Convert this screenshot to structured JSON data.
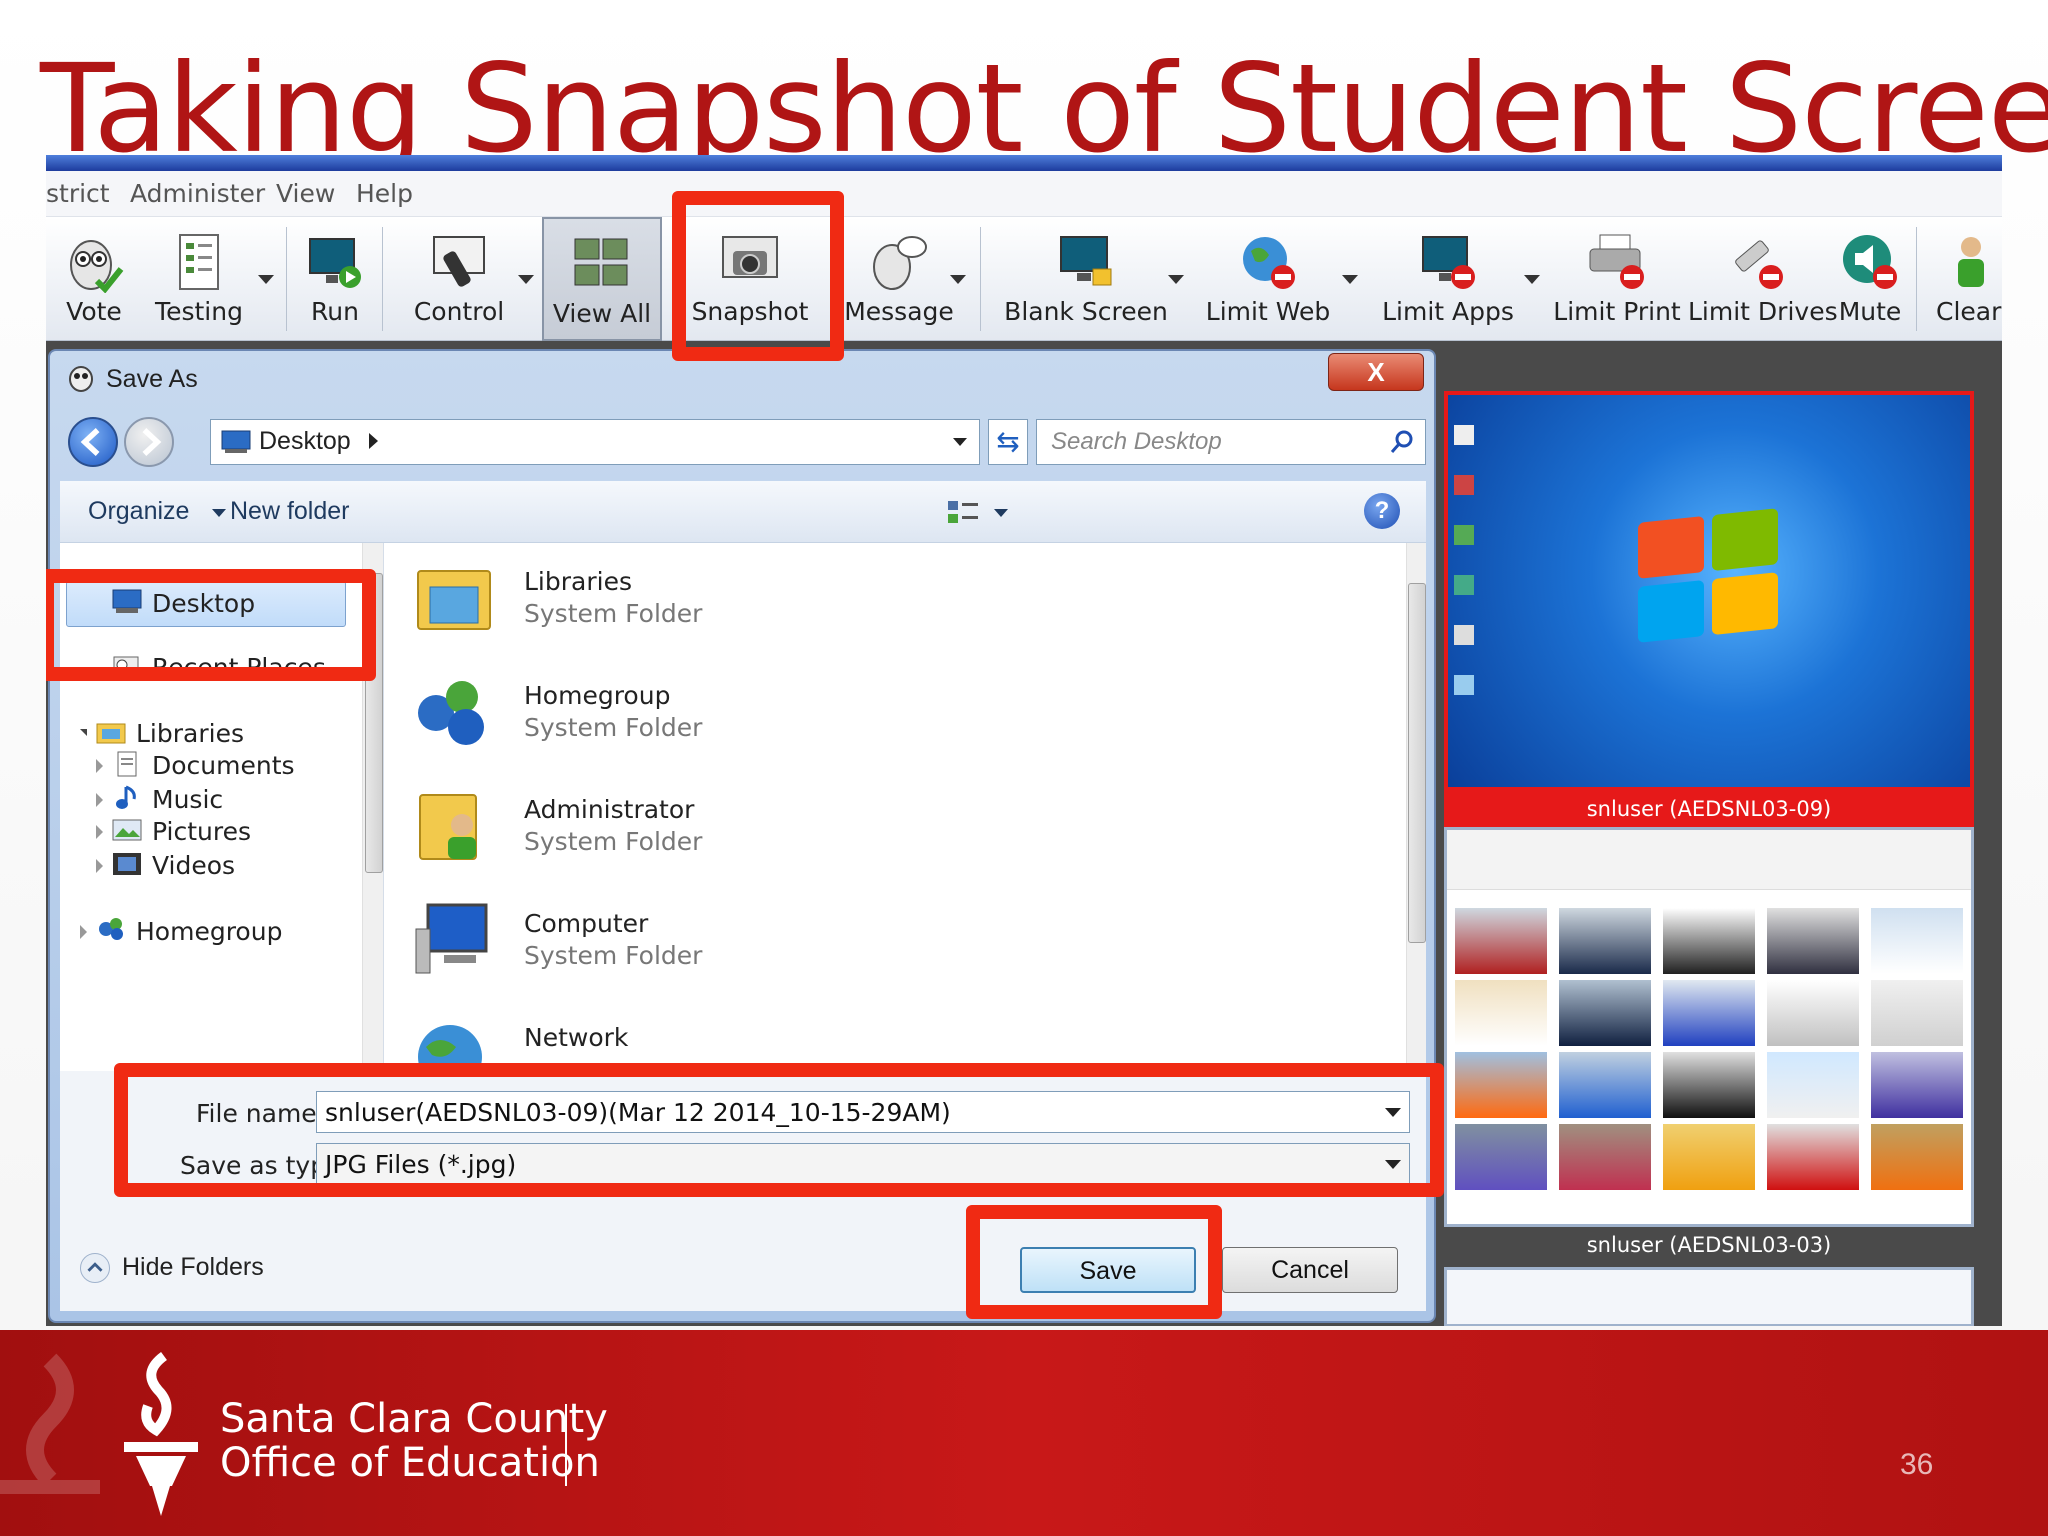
{
  "slide": {
    "title": "Taking Snapshot of Student Screen",
    "page_number": "36",
    "footer": {
      "org_line1": "Santa Clara County",
      "org_line2": "Office of Education",
      "logo": "torch-logo"
    }
  },
  "menubar": {
    "items": [
      "strict",
      "Administer",
      "View",
      "Help"
    ]
  },
  "toolbar": {
    "buttons": [
      {
        "label": "Vote",
        "icon": "owl-check-icon"
      },
      {
        "label": "Testing",
        "icon": "test-sheet-icon"
      },
      {
        "label": "Run",
        "icon": "run-monitor-icon"
      },
      {
        "label": "Control",
        "icon": "remote-control-icon"
      },
      {
        "label": "View All",
        "icon": "view-all-icon"
      },
      {
        "label": "Snapshot",
        "icon": "camera-icon"
      },
      {
        "label": "Message",
        "icon": "owl-message-icon"
      },
      {
        "label": "Blank Screen",
        "icon": "blank-screen-lock-icon"
      },
      {
        "label": "Limit Web",
        "icon": "globe-block-icon"
      },
      {
        "label": "Limit Apps",
        "icon": "monitor-block-icon"
      },
      {
        "label": "Limit Print",
        "icon": "printer-block-icon"
      },
      {
        "label": "Limit Drives",
        "icon": "drive-block-icon"
      },
      {
        "label": "Mute",
        "icon": "speaker-mute-icon"
      },
      {
        "label": "Clear I",
        "icon": "user-icon"
      }
    ]
  },
  "dialog": {
    "title": "Save As",
    "close_label": "X",
    "address": "Desktop",
    "search_placeholder": "Search Desktop",
    "organize_label": "Organize",
    "new_folder_label": "New folder",
    "help_label": "?",
    "nav_items": [
      {
        "label": "Desktop",
        "selected": true
      },
      {
        "label": "Recent Places"
      },
      {
        "label": "Libraries"
      },
      {
        "label": "Documents"
      },
      {
        "label": "Music"
      },
      {
        "label": "Pictures"
      },
      {
        "label": "Videos"
      },
      {
        "label": "Homegroup"
      }
    ],
    "files": [
      {
        "name": "Libraries",
        "type": "System Folder"
      },
      {
        "name": "Homegroup",
        "type": "System Folder"
      },
      {
        "name": "Administrator",
        "type": "System Folder"
      },
      {
        "name": "Computer",
        "type": "System Folder"
      },
      {
        "name": "Network",
        "type": ""
      }
    ],
    "file_name_label": "File name:",
    "file_name_value": "snluser(AEDSNL03-09)(Mar 12 2014_10-15-29AM)",
    "save_type_label": "Save as type:",
    "save_type_value": "JPG Files (*.jpg)",
    "hide_folders_label": "Hide Folders",
    "save_label": "Save",
    "cancel_label": "Cancel"
  },
  "thumbnails": [
    {
      "label": "snluser (AEDSNL03-09)",
      "selected": true
    },
    {
      "label": "snluser (AEDSNL03-03)",
      "selected": false
    }
  ],
  "colors": {
    "title_red": "#b01515",
    "highlight_red": "#f02a13",
    "footer_red": "#c81818",
    "accent_blue": "#1d3c9d"
  }
}
